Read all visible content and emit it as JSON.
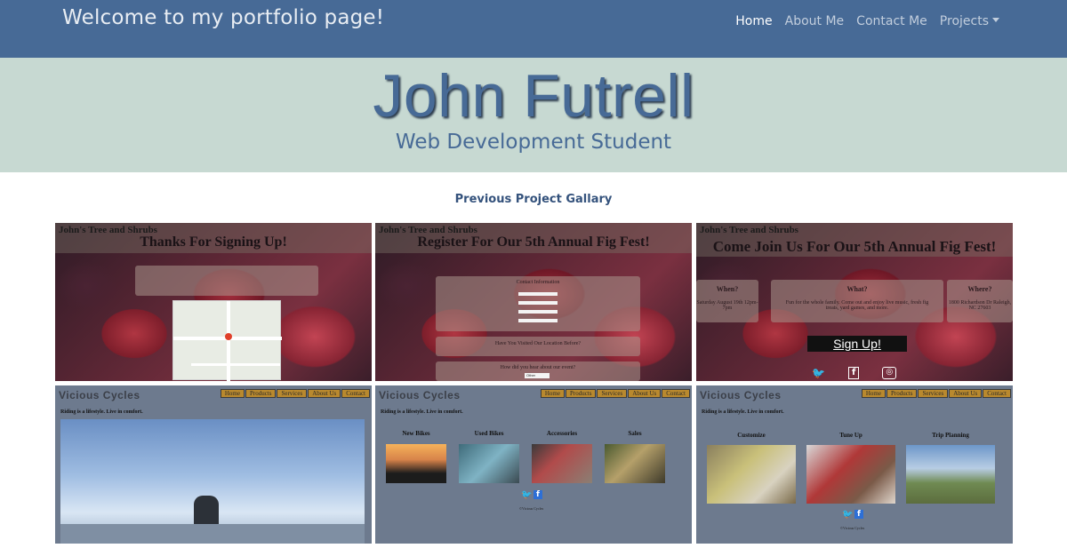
{
  "navbar": {
    "brand": "Welcome to my portfolio page!",
    "links": [
      {
        "label": "Home",
        "active": true
      },
      {
        "label": "About Me",
        "active": false
      },
      {
        "label": "Contact Me",
        "active": false
      },
      {
        "label": "Projects",
        "active": false,
        "dropdown": true
      }
    ]
  },
  "hero": {
    "name": "John Futrell",
    "subtitle": "Web Development Student"
  },
  "gallery": {
    "title": "Previous Project Gallary",
    "tree_site": {
      "logo": "John's Tree and Shrubs",
      "tiles": [
        {
          "title": "Thanks For Signing Up!"
        },
        {
          "title": "Register For Our 5th Annual Fig Fest!",
          "form_heading": "Contact Information",
          "question1": "Have You Visited Our Location Before?",
          "question2": "How did you hear about our event?",
          "select_value": "Other"
        },
        {
          "title": "Come Join Us For Our 5th Annual Fig Fest!",
          "columns": [
            "When?",
            "What?",
            "Where?"
          ],
          "when_text": "Saturday August 19th 12pm-7pm",
          "what_text": "Fun for the whole family. Come out and enjoy live music, fresh fig treats, yard games, and more.",
          "where_text": "1800 Richardson Dr Raleigh, NC 27603",
          "button": "Sign Up!",
          "social_icons": [
            "twitter-icon",
            "facebook-icon",
            "instagram-icon"
          ]
        }
      ]
    },
    "cycles_site": {
      "logo": "Vicious Cycles",
      "nav": [
        "Home",
        "Products",
        "Services",
        "About Us",
        "Contact"
      ],
      "tagline": "Riding is a lifestyle. Live in comfort.",
      "footer": "©Vicious Cycles",
      "products_columns": [
        "New Bikes",
        "Used Bikes",
        "Accessories",
        "Sales"
      ],
      "services_columns": [
        "Customize",
        "Tune Up",
        "Trip Planning"
      ]
    }
  },
  "colors": {
    "navbar_bg": "#476a96",
    "hero_bg": "#c7d9d2",
    "accent": "#476a96",
    "cycles_bg": "#6d7a8e"
  }
}
